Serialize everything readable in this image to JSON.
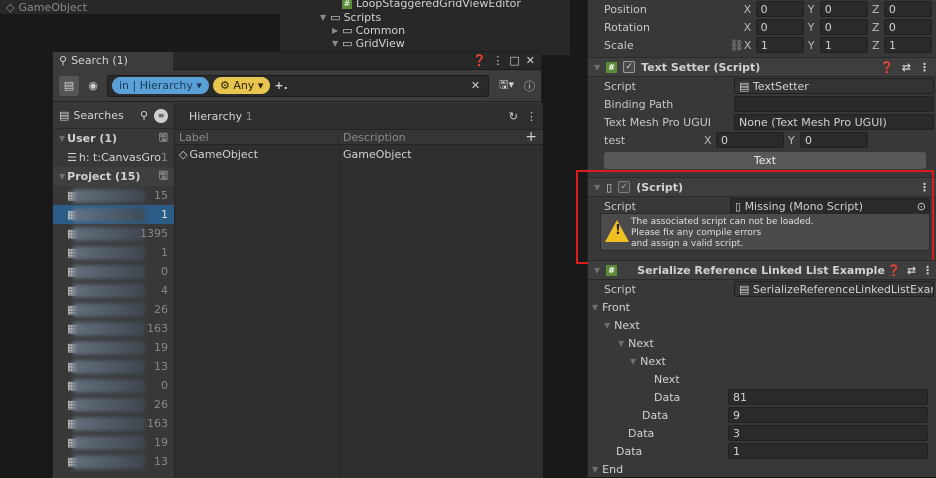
{
  "hierarchy": {
    "root": "GameObject"
  },
  "project": {
    "items": [
      {
        "label": "LoopStaggeredGridViewEditor"
      },
      {
        "label": "Scripts"
      },
      {
        "label": "Common"
      },
      {
        "label": "GridView"
      }
    ]
  },
  "search_window": {
    "tab_title": "Search (1)",
    "query": {
      "in_label": "in",
      "scope": "Hierarchy",
      "filter": "Any",
      "add": "+."
    },
    "searches_label": "Searches",
    "sections": [
      {
        "name": "User (1)",
        "rows": [
          {
            "label": "h: t:CanvasGro",
            "count": "1"
          }
        ]
      },
      {
        "name": "Project (15)",
        "rows": [
          {
            "count": "15"
          },
          {
            "count": "1"
          },
          {
            "count": "1395"
          },
          {
            "count": "1"
          },
          {
            "count": "0"
          },
          {
            "count": "4"
          },
          {
            "count": "26"
          },
          {
            "count": "163"
          },
          {
            "count": "19"
          },
          {
            "count": "13"
          },
          {
            "count": "0"
          },
          {
            "count": "26"
          },
          {
            "count": "163"
          },
          {
            "count": "19"
          },
          {
            "count": "13"
          }
        ]
      }
    ],
    "results_header": {
      "title": "Hierarchy",
      "count": "1"
    },
    "columns": [
      "Label",
      "Description"
    ],
    "results": [
      {
        "label": "GameObject",
        "description": "GameObject"
      }
    ]
  },
  "inspector": {
    "transform": {
      "position": {
        "label": "Position",
        "x": "0",
        "y": "0",
        "z": "0"
      },
      "rotation": {
        "label": "Rotation",
        "x": "0",
        "y": "0",
        "z": "0"
      },
      "scale": {
        "label": "Scale",
        "x": "1",
        "y": "1",
        "z": "1"
      }
    },
    "text_setter": {
      "title": "Text Setter (Script)",
      "script_label": "Script",
      "script_value": "TextSetter",
      "binding_label": "Binding Path",
      "binding_value": "",
      "tmp_label": "Text Mesh Pro UGUI",
      "tmp_value": "None (Text Mesh Pro UGUI)",
      "test_label": "test",
      "test_x": "0",
      "test_y": "0",
      "button": "Text"
    },
    "missing": {
      "title": "(Script)",
      "script_label": "Script",
      "script_value": "Missing (Mono Script)",
      "warning_lines": [
        "The associated script can not be loaded.",
        "Please fix any compile errors",
        "and assign a valid script."
      ]
    },
    "linked_list": {
      "title": "Serialize Reference Linked List Example (Scrip",
      "script_label": "Script",
      "script_value": "SerializeReferenceLinkedListExampl",
      "front": "Front",
      "next": "Next",
      "data": "Data",
      "values": [
        "81",
        "9",
        "3",
        "1"
      ],
      "end": "End"
    }
  },
  "colors": {
    "accent_selection": "#2c5d87",
    "highlight_box": "#d91c1c",
    "warning": "#f0c020",
    "hierarchy_chip": "#5aa1d8",
    "any_chip": "#e8c451"
  }
}
